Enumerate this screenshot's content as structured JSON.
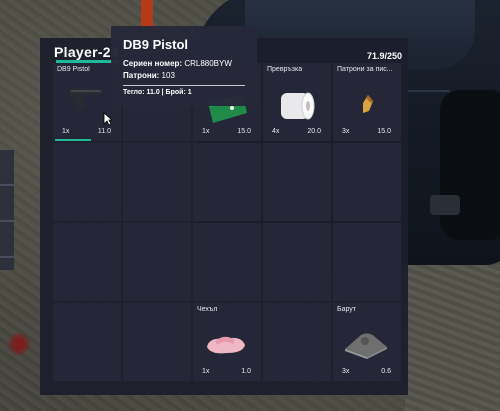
{
  "inventory": {
    "player_name": "Player-24",
    "weight": "71.9/250",
    "slots": [
      {
        "name": "DB9 Pistol",
        "qty": "1x",
        "weight": "11.0",
        "icon": "pistol-icon"
      },
      {
        "name": "",
        "qty": "",
        "weight": "",
        "icon": ""
      },
      {
        "name": "",
        "qty": "1x",
        "weight": "15.0",
        "icon": "bag-icon"
      },
      {
        "name": "Превръзка",
        "qty": "4x",
        "weight": "20.0",
        "icon": "bandage-roll-icon"
      },
      {
        "name": "Патрони за пис...",
        "qty": "3x",
        "weight": "15.0",
        "icon": "bullet-icon"
      },
      {
        "name": "Чехъл",
        "qty": "1x",
        "weight": "1.0",
        "icon": "slipper-icon"
      },
      {
        "name": "Барут",
        "qty": "3x",
        "weight": "0.6",
        "icon": "gunpowder-icon"
      }
    ]
  },
  "tooltip": {
    "title": "DB9 Pistol",
    "serial_label": "Сериен номер:",
    "serial_value": "CRL880BYW",
    "ammo_label": "Патрони:",
    "ammo_value": "103",
    "meta": "Тегло: 11.0 | Брой: 1"
  },
  "colors": {
    "accent": "#1fb89b",
    "panel": "#1c1e2c",
    "slot": "#252738"
  }
}
